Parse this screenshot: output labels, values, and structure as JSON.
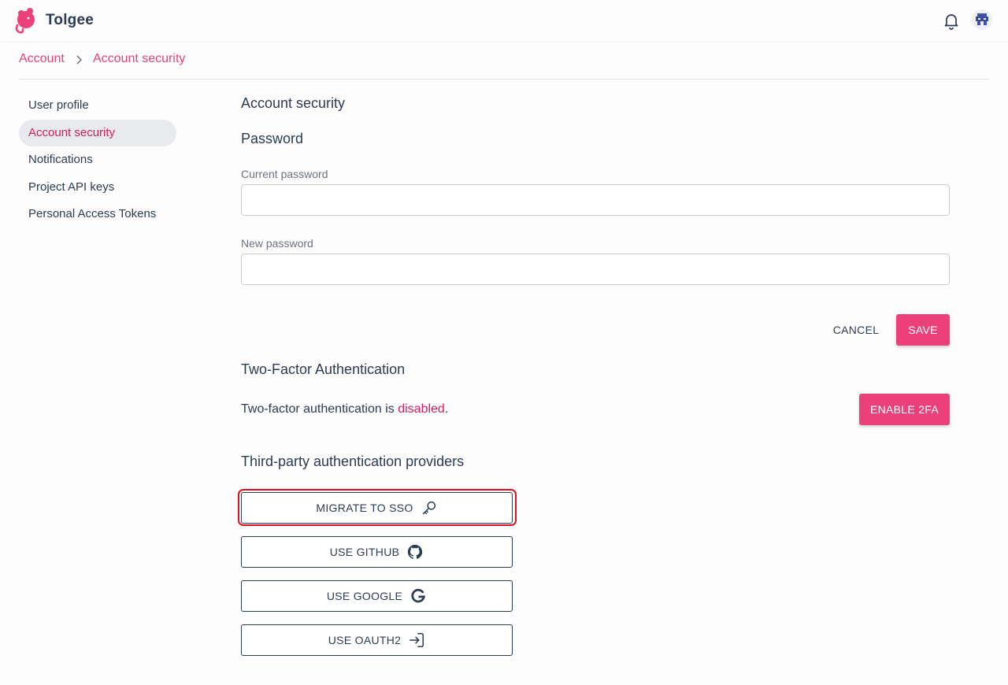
{
  "app": {
    "brand": "Tolgee"
  },
  "breadcrumb": {
    "root": "Account",
    "current": "Account security"
  },
  "sidebar": {
    "items": [
      {
        "label": "User profile"
      },
      {
        "label": "Account security",
        "active": true
      },
      {
        "label": "Notifications"
      },
      {
        "label": "Project API keys"
      },
      {
        "label": "Personal Access Tokens"
      }
    ]
  },
  "main": {
    "title": "Account security",
    "password": {
      "heading": "Password",
      "current_label": "Current password",
      "current_value": "",
      "new_label": "New password",
      "new_value": "",
      "cancel_label": "CANCEL",
      "save_label": "SAVE"
    },
    "two_factor": {
      "heading": "Two-Factor Authentication",
      "status_prefix": "Two-factor authentication is ",
      "status_value": "disabled",
      "status_suffix": ".",
      "enable_label": "ENABLE 2FA"
    },
    "providers": {
      "heading": "Third-party authentication providers",
      "buttons": [
        {
          "label": "MIGRATE TO SSO",
          "icon": "key-icon"
        },
        {
          "label": "USE GITHUB",
          "icon": "github-icon"
        },
        {
          "label": "USE GOOGLE",
          "icon": "google-icon"
        },
        {
          "label": "USE OAUTH2",
          "icon": "login-arrow-icon"
        }
      ]
    }
  },
  "colors": {
    "accent": "#ec407a",
    "accent_dark": "#d81b60",
    "text": "#2c3c52",
    "highlight": "#e0101c"
  }
}
